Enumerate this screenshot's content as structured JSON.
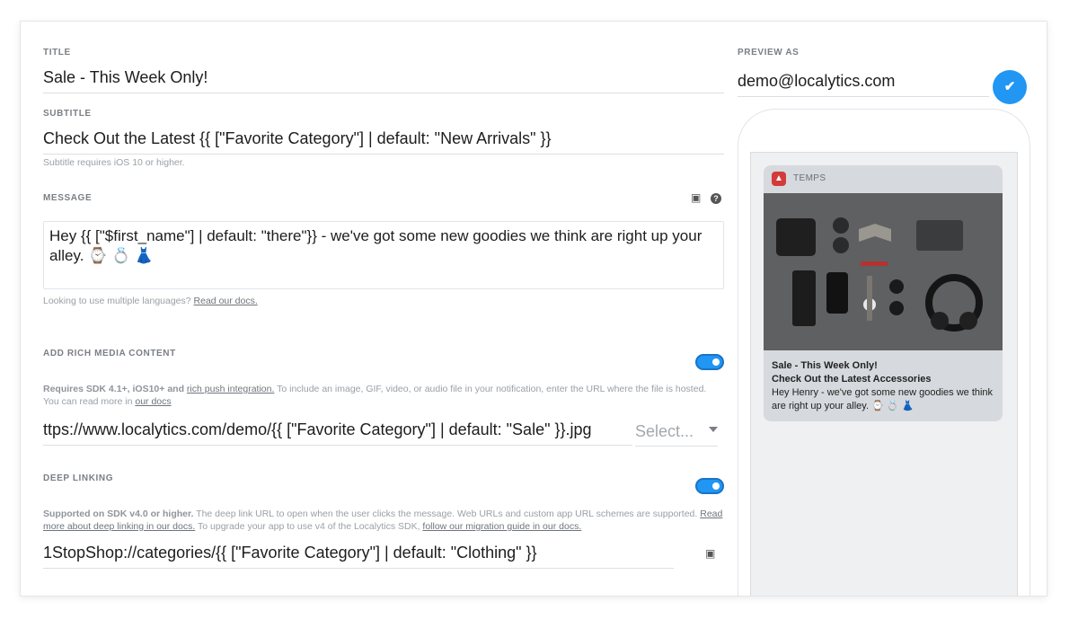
{
  "form": {
    "title_label": "TITLE",
    "title_value": "Sale - This Week Only!",
    "subtitle_label": "SUBTITLE",
    "subtitle_value": "Check Out the Latest {{ [\"Favorite Category\"] | default: \"New Arrivals\" }}",
    "subtitle_hint": "Subtitle requires iOS 10 or higher.",
    "message_label": "MESSAGE",
    "message_value": "Hey {{ [\"$first_name\"] | default: \"there\"}} - we've got some new goodies we think are right up your alley. ⌚ 💍 👗",
    "languages_hint_prefix": "Looking to use multiple languages? ",
    "languages_hint_link": "Read our docs.",
    "rich_media_label": "ADD RICH MEDIA CONTENT",
    "rich_media_hint_bold": "Requires SDK 4.1+, iOS10+ and ",
    "rich_media_hint_link1": "rich push integration.",
    "rich_media_hint_rest": " To include an image, GIF, video, or audio file in your notification, enter the URL where the file is hosted. You can read more in ",
    "rich_media_hint_link2": "our docs",
    "rich_media_url": "ttps://www.localytics.com/demo/{{ [\"Favorite Category\"] | default: \"Sale\" }}.jpg",
    "rich_media_select": "Select...",
    "deep_link_label": "DEEP LINKING",
    "deep_link_hint_bold": "Supported on SDK v4.0 or higher.",
    "deep_link_hint_rest1": " The deep link URL to open when the user clicks the message. Web URLs and custom app URL schemes are supported. ",
    "deep_link_hint_link1": "Read more about deep linking in our docs.",
    "deep_link_hint_rest2": " To upgrade your app to use v4 of the Localytics SDK, ",
    "deep_link_hint_link2": "follow our migration guide in our docs.",
    "deep_link_value": "1StopShop://categories/{{ [\"Favorite Category\"] | default: \"Clothing\" }}"
  },
  "preview": {
    "label": "PREVIEW AS",
    "email": "demo@localytics.com",
    "notification": {
      "app_name": "TEMPS",
      "title": "Sale - This Week Only!",
      "subtitle": "Check Out the Latest Accessories",
      "body": "Hey Henry - we've got some new goodies we think are right up your alley. ⌚ 💍 👗"
    }
  },
  "icons": {
    "personalize": "personalize-icon",
    "help": "help-icon",
    "check": "check-icon"
  },
  "colors": {
    "accent": "#2196f3"
  }
}
